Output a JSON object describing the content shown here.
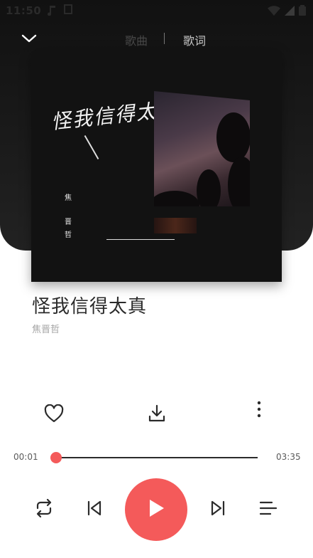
{
  "status_bar": {
    "time": "11:50"
  },
  "header": {
    "tab_song": "歌曲",
    "tab_lyrics": "歌词"
  },
  "cover": {
    "title_text": "怪我信得太真",
    "artist_chars": [
      "焦",
      "晋",
      "哲"
    ]
  },
  "song": {
    "title": "怪我信得太真",
    "artist": "焦晋哲"
  },
  "player": {
    "current_time": "00:01",
    "total_time": "03:35",
    "progress_fraction": 0.005,
    "accent_color": "#f45a5a"
  },
  "icons": {
    "collapse": "chevron-down-icon",
    "like": "heart-icon",
    "download": "download-icon",
    "more": "more-vertical-icon",
    "repeat": "repeat-icon",
    "prev": "skip-previous-icon",
    "play": "play-icon",
    "next": "skip-next-icon",
    "playlist": "playlist-icon"
  }
}
